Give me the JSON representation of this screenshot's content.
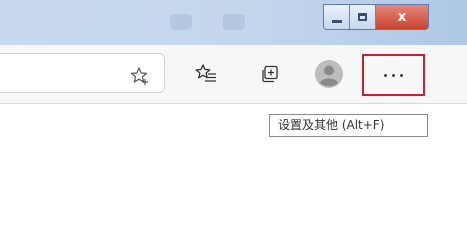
{
  "window": {
    "minimize_icon": "minimize-icon",
    "restore_icon": "restore-icon",
    "close_label": "x",
    "close_color": "#c9442f"
  },
  "toolbar": {
    "favorite_icon": "star-add-icon",
    "favorites_icon": "favorites-list-icon",
    "collections_icon": "collections-icon",
    "profile_icon": "profile-avatar-icon",
    "more_icon": "more-dots-icon",
    "more_highlight_color": "#cc2030"
  },
  "tooltip": {
    "text": "设置及其他 (Alt+F)"
  }
}
